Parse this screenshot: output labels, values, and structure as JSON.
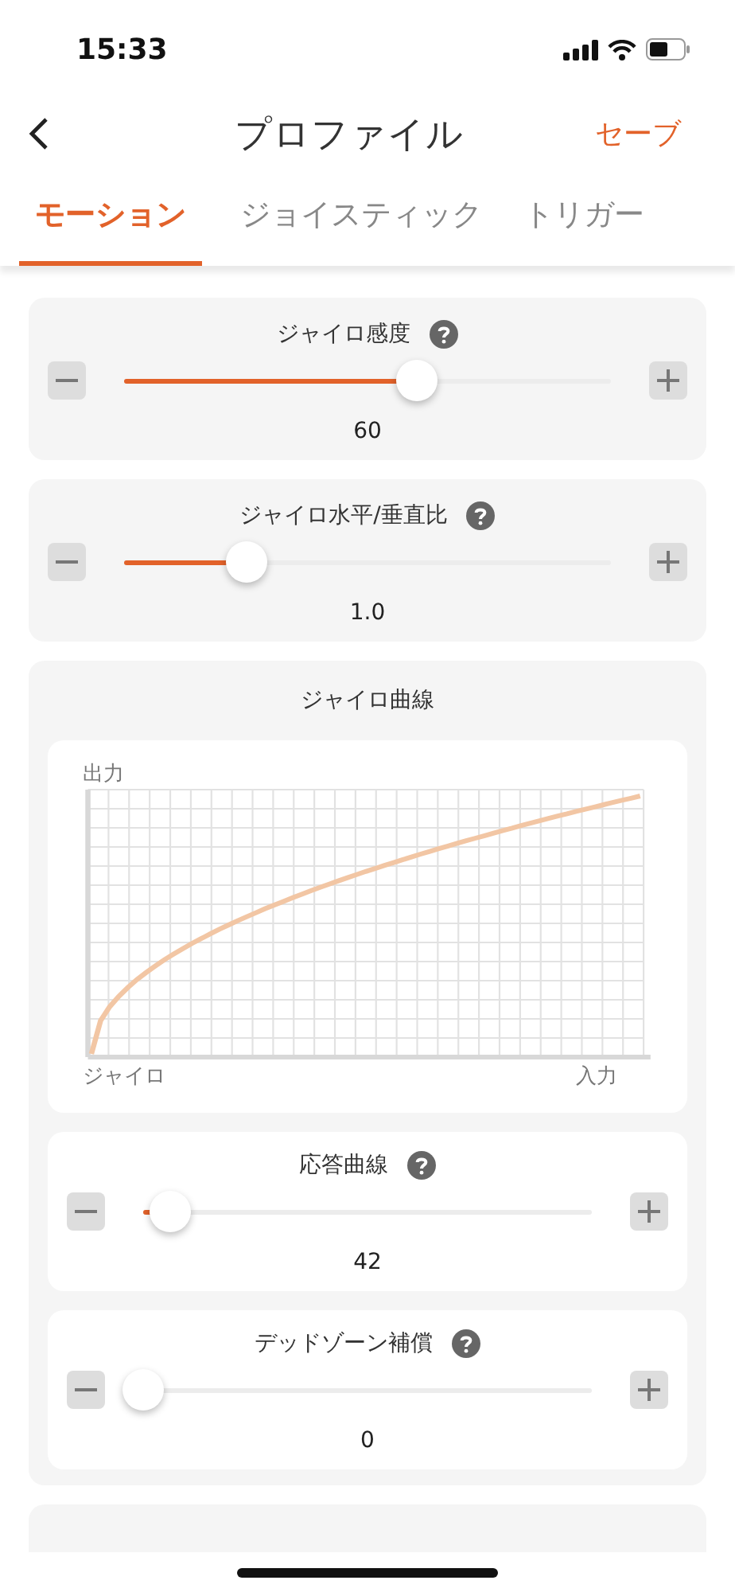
{
  "status_bar": {
    "time": "15:33"
  },
  "nav": {
    "title": "プロファイル",
    "action": "セーブ"
  },
  "tabs": [
    {
      "label": "モーション",
      "selected": true
    },
    {
      "label": "ジョイスティック",
      "selected": false
    },
    {
      "label": "トリガー",
      "selected": false
    }
  ],
  "sliders": [
    {
      "label": "ジャイロ感度",
      "level": 0.6,
      "reading": "60"
    },
    {
      "label": "ジャイロ水平/垂直比",
      "level": 0.25,
      "reading": "1.0"
    }
  ],
  "curve": {
    "title": "ジャイロ曲線",
    "y_label": "出力",
    "x_label_start": "ジャイロ",
    "x_label_end": "入力",
    "sliders": [
      {
        "label": "応答曲線",
        "level": 0.06,
        "reading": "42"
      },
      {
        "label": "デッドゾーン補償",
        "level": 0,
        "reading": "0"
      }
    ]
  }
}
